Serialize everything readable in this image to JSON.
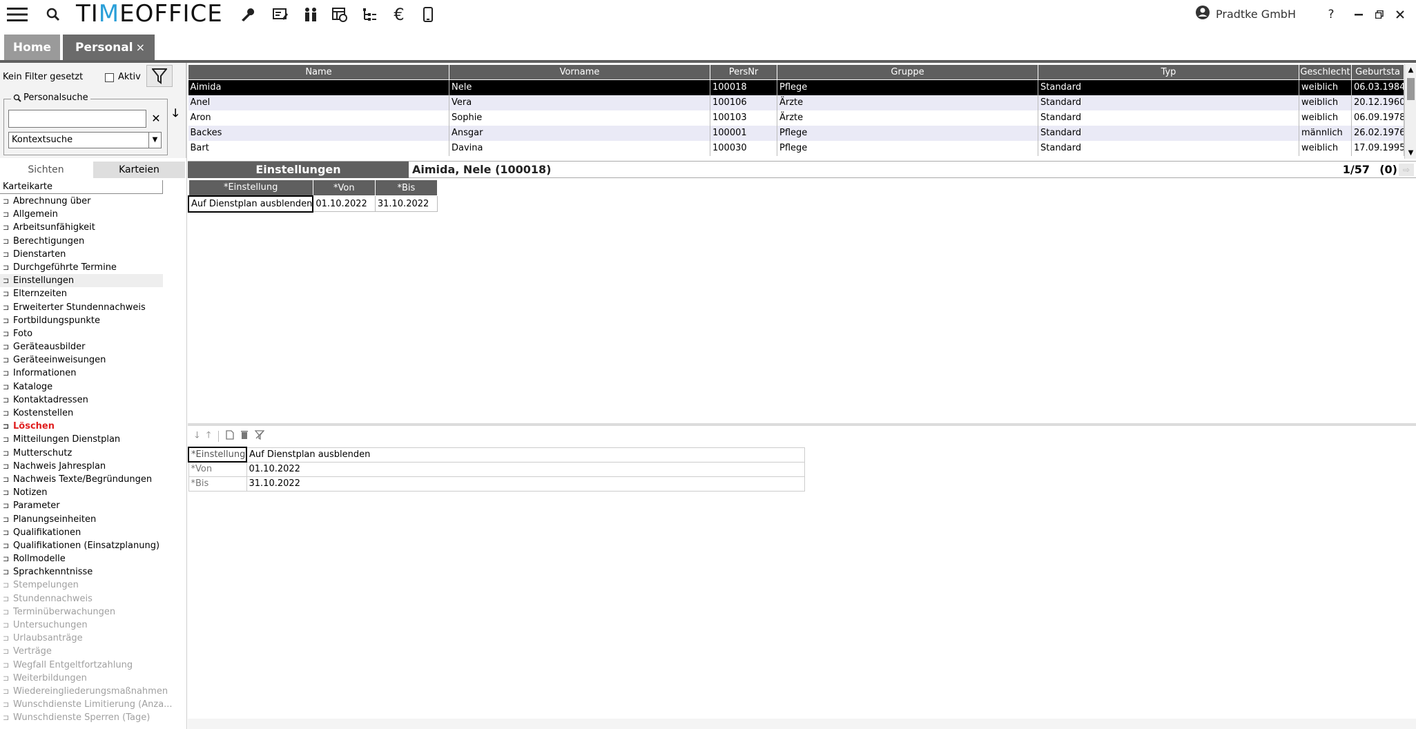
{
  "app": {
    "logo": "TIMEOFFICE",
    "company": "Pradtke GmbH",
    "help": "?",
    "icons": [
      "menu-icon",
      "search-icon",
      "wrench-icon",
      "list-edit-icon",
      "people-icon",
      "calendar-table-icon",
      "tree-icon",
      "euro-icon",
      "mobile-icon"
    ]
  },
  "tabs": [
    {
      "label": "Home"
    },
    {
      "label": "Personal",
      "close": "×"
    }
  ],
  "filter": {
    "status": "Kein Filter gesetzt",
    "aktiv_label": "Aktiv",
    "group_label": "Personalsuche",
    "search_value": "",
    "context_value": "Kontextsuche"
  },
  "view_tabs": [
    "Sichten",
    "Karteien"
  ],
  "karteikarte": {
    "header": "Karteikarte",
    "items": [
      {
        "label": "Abrechnung über",
        "state": "normal"
      },
      {
        "label": "Allgemein",
        "state": "normal"
      },
      {
        "label": "Arbeitsunfähigkeit",
        "state": "normal"
      },
      {
        "label": "Berechtigungen",
        "state": "normal"
      },
      {
        "label": "Dienstarten",
        "state": "normal"
      },
      {
        "label": "Durchgeführte Termine",
        "state": "normal"
      },
      {
        "label": "Einstellungen",
        "state": "selected"
      },
      {
        "label": "Elternzeiten",
        "state": "normal"
      },
      {
        "label": "Erweiterter Stundennachweis",
        "state": "normal"
      },
      {
        "label": "Fortbildungspunkte",
        "state": "normal"
      },
      {
        "label": "Foto",
        "state": "normal"
      },
      {
        "label": "Geräteausbilder",
        "state": "normal"
      },
      {
        "label": "Geräteeinweisungen",
        "state": "normal"
      },
      {
        "label": "Informationen",
        "state": "normal"
      },
      {
        "label": "Kataloge",
        "state": "normal"
      },
      {
        "label": "Kontaktadressen",
        "state": "normal"
      },
      {
        "label": "Kostenstellen",
        "state": "normal"
      },
      {
        "label": "Löschen",
        "state": "red"
      },
      {
        "label": "Mitteilungen Dienstplan",
        "state": "normal"
      },
      {
        "label": "Mutterschutz",
        "state": "normal"
      },
      {
        "label": "Nachweis Jahresplan",
        "state": "normal"
      },
      {
        "label": "Nachweis Texte/Begründungen",
        "state": "normal"
      },
      {
        "label": "Notizen",
        "state": "normal"
      },
      {
        "label": "Parameter",
        "state": "normal"
      },
      {
        "label": "Planungseinheiten",
        "state": "normal"
      },
      {
        "label": "Qualifikationen",
        "state": "normal"
      },
      {
        "label": "Qualifikationen (Einsatzplanung)",
        "state": "normal"
      },
      {
        "label": "Rollmodelle",
        "state": "normal"
      },
      {
        "label": "Sprachkenntnisse",
        "state": "normal"
      },
      {
        "label": "Stempelungen",
        "state": "grey"
      },
      {
        "label": "Stundennachweis",
        "state": "grey"
      },
      {
        "label": "Terminüberwachungen",
        "state": "grey"
      },
      {
        "label": "Untersuchungen",
        "state": "grey"
      },
      {
        "label": "Urlaubsanträge",
        "state": "grey"
      },
      {
        "label": "Verträge",
        "state": "grey"
      },
      {
        "label": "Wegfall Entgeltfortzahlung",
        "state": "grey"
      },
      {
        "label": "Weiterbildungen",
        "state": "grey"
      },
      {
        "label": "Wiedereingliederungsmaßnahmen",
        "state": "grey"
      },
      {
        "label": "Wunschdienste Limitierung (Anza...",
        "state": "grey"
      },
      {
        "label": "Wunschdienste Sperren (Tage)",
        "state": "grey"
      }
    ]
  },
  "personal_grid": {
    "columns": [
      "Name",
      "Vorname",
      "PersNr",
      "Gruppe",
      "Typ",
      "Geschlecht",
      "Geburtsta"
    ],
    "rows": [
      [
        "Aimida",
        "Nele",
        "100018",
        "Pflege",
        "Standard",
        "weiblich",
        "06.03.1984"
      ],
      [
        "Anel",
        "Vera",
        "100106",
        "Ärzte",
        "Standard",
        "weiblich",
        "20.12.1960"
      ],
      [
        "Aron",
        "Sophie",
        "100103",
        "Ärzte",
        "Standard",
        "weiblich",
        "06.09.1978"
      ],
      [
        "Backes",
        "Ansgar",
        "100001",
        "Pflege",
        "Standard",
        "männlich",
        "26.02.1976"
      ],
      [
        "Bart",
        "Davina",
        "100030",
        "Pflege",
        "Standard",
        "weiblich",
        "17.09.1995"
      ]
    ]
  },
  "infobar": {
    "section": "Einstellungen",
    "person": "Aimida, Nele (100018)",
    "count": "1/57",
    "paren": "(0)",
    "next": "⇨"
  },
  "einstellungen": {
    "columns": [
      "*Einstellung",
      "*Von",
      "*Bis"
    ],
    "rows": [
      [
        "Auf Dienstplan ausblenden",
        "01.10.2022",
        "31.10.2022"
      ]
    ]
  },
  "detail": {
    "rows": [
      {
        "label": "*Einstellung",
        "value": "Auf Dienstplan ausblenden"
      },
      {
        "label": "*Von",
        "value": "01.10.2022"
      },
      {
        "label": "*Bis",
        "value": "31.10.2022"
      }
    ]
  },
  "colors": {
    "header_grey": "#5f5f5f",
    "selected_row": "#000000",
    "alt_row": "#eaeaf6",
    "delete_red": "#e02020",
    "logo_accent": "#2a9fd8"
  }
}
